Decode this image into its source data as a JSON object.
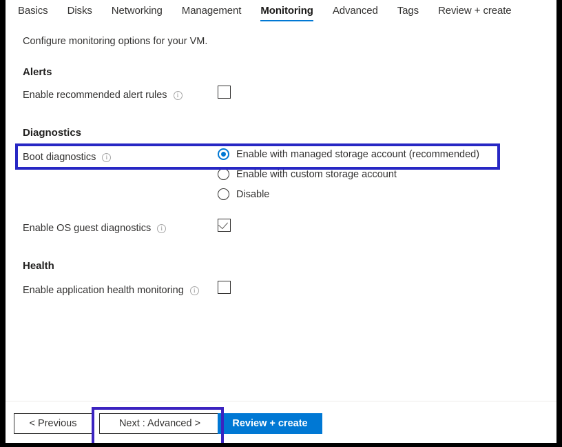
{
  "tabs": [
    {
      "label": "Basics",
      "active": false
    },
    {
      "label": "Disks",
      "active": false
    },
    {
      "label": "Networking",
      "active": false
    },
    {
      "label": "Management",
      "active": false
    },
    {
      "label": "Monitoring",
      "active": true
    },
    {
      "label": "Advanced",
      "active": false
    },
    {
      "label": "Tags",
      "active": false
    },
    {
      "label": "Review + create",
      "active": false
    }
  ],
  "intro": "Configure monitoring options for your VM.",
  "sections": {
    "alerts": {
      "heading": "Alerts",
      "alert_rules_label": "Enable recommended alert rules",
      "alert_rules_checked": false
    },
    "diagnostics": {
      "heading": "Diagnostics",
      "boot_diagnostics_label": "Boot diagnostics",
      "boot_options": [
        {
          "label": "Enable with managed storage account (recommended)",
          "selected": true
        },
        {
          "label": "Enable with custom storage account",
          "selected": false
        },
        {
          "label": "Disable",
          "selected": false
        }
      ],
      "os_guest_label": "Enable OS guest diagnostics",
      "os_guest_checked": true
    },
    "health": {
      "heading": "Health",
      "app_health_label": "Enable application health monitoring",
      "app_health_checked": false
    }
  },
  "footer": {
    "previous_label": "< Previous",
    "next_label": "Next : Advanced >",
    "review_label": "Review + create"
  },
  "colors": {
    "accent": "#0078d4",
    "highlight_box": "#2727c4",
    "text": "#323130"
  }
}
